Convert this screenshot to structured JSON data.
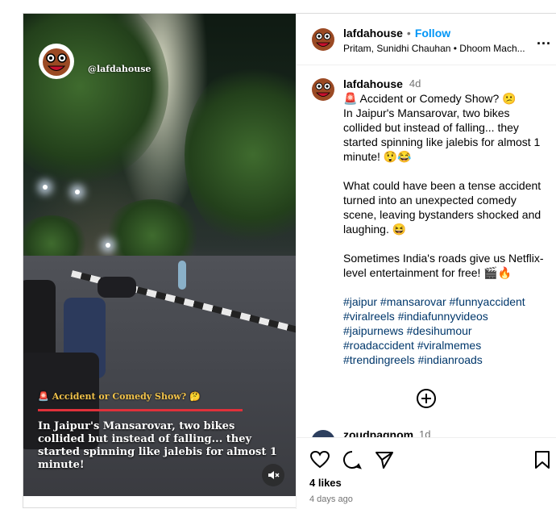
{
  "video": {
    "watermark": "@lafdahouse",
    "caption_title": "Accident or Comedy Show?",
    "caption_title_emoji_left": "🚨",
    "caption_title_emoji_right": "🤔",
    "caption_body": "In Jaipur's Mansarovar, two bikes collided but instead of falling... they started spinning like jalebis for almost 1 minute!",
    "mute_icon": "speaker-muted-icon"
  },
  "header": {
    "username": "lafdahouse",
    "separator": "•",
    "follow_label": "Follow",
    "audio": "Pritam, Sunidhi Chauhan • Dhoom Mach...",
    "more_label": "..."
  },
  "caption": {
    "username": "lafdahouse",
    "time": "4d",
    "line1": "🚨 Accident or Comedy Show? 😕",
    "line2": "In Jaipur's Mansarovar, two bikes collided but instead of falling... they started spinning like jalebis for almost 1 minute! 😲😂",
    "para2": "What could have been a tense accident turned into an unexpected comedy scene, leaving bystanders shocked and laughing. 😆",
    "para3": "Sometimes India's roads give us Netflix-level entertainment for free! 🎬🔥",
    "hashtags": [
      "#jaipur",
      "#mansarovar",
      "#funnyaccident",
      "#viralreels",
      "#indiafunnyvideos",
      "#jaipurnews",
      "#desihumour",
      "#roadaccident",
      "#viralmemes",
      "#trendingreels",
      "#indianroads"
    ]
  },
  "next_comment": {
    "username": "zoudpagnom",
    "time": "1d"
  },
  "actions": {
    "likes": "4 likes",
    "posted": "4 days ago"
  },
  "colors": {
    "accent": "#0095f6",
    "hashtag": "#00376b",
    "caption_title": "#f3c44b",
    "caption_rule": "#e0313a"
  }
}
